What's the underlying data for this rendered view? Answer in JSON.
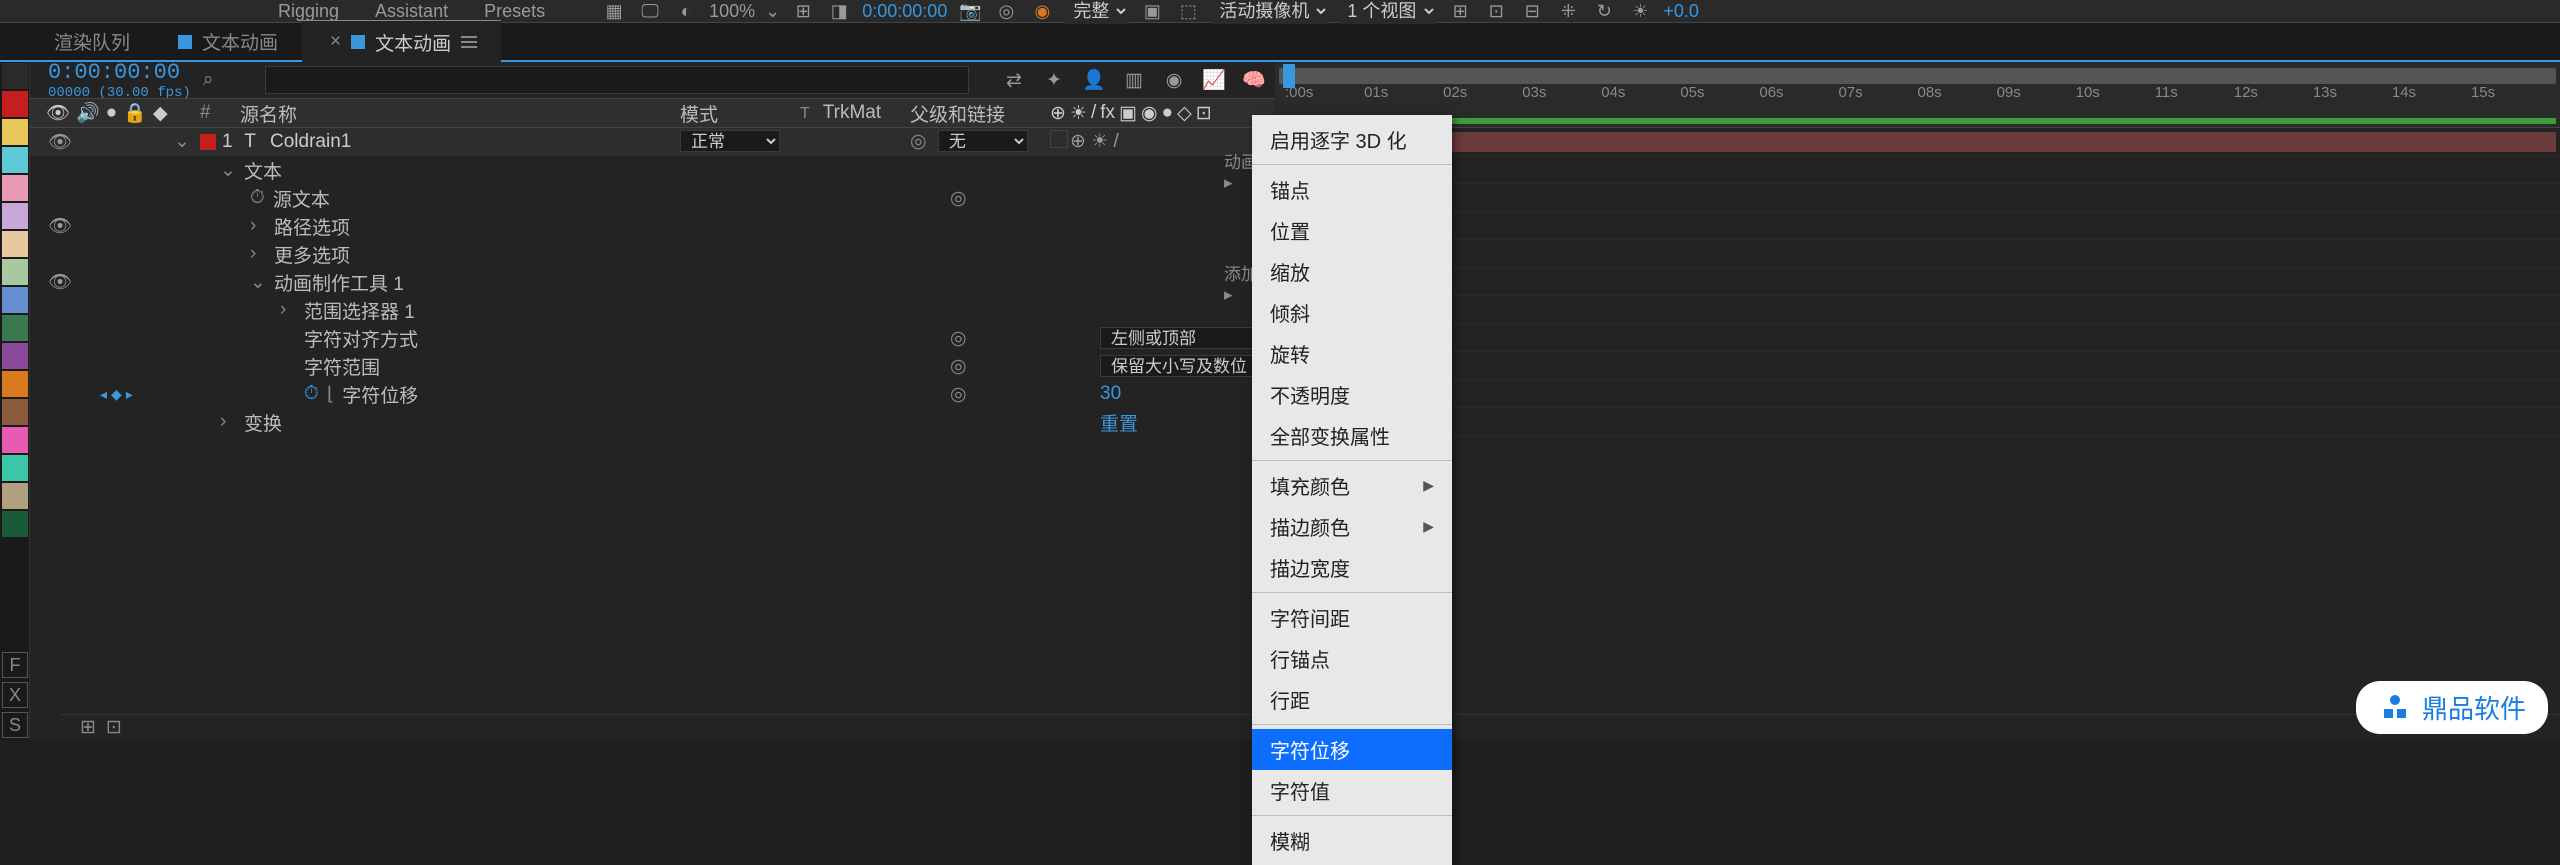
{
  "toolbar": {
    "tabs": [
      "Rigging",
      "Assistant",
      "Presets"
    ],
    "zoom": "100%",
    "timecode": "0:00:00:00",
    "quality": "完整",
    "camera": "活动摄像机",
    "views": "1 个视图",
    "exposure": "+0.0"
  },
  "panel_tabs": {
    "tab1": "渲染队列",
    "tab2": "文本动画",
    "tab3": "文本动画"
  },
  "timeline": {
    "timecode": "0:00:00:00",
    "frame_info": "00000 (30.00 fps)",
    "search_placeholder": "",
    "columns": {
      "hash": "#",
      "source_name": "源名称",
      "mode": "模式",
      "t": "T",
      "trkmat": "TrkMat",
      "parent": "父级和链接"
    },
    "ruler_ticks": [
      ":00s",
      "01s",
      "02s",
      "03s",
      "04s",
      "05s",
      "06s",
      "07s",
      "08s",
      "09s",
      "10s",
      "11s",
      "12s",
      "13s",
      "14s",
      "15s"
    ]
  },
  "layers": {
    "main": {
      "index": "1",
      "name": "Coldrain1",
      "mode": "正常",
      "parent": "无"
    },
    "text_group": "文本",
    "source_text": "源文本",
    "path_options": "路径选项",
    "more_options": "更多选项",
    "animator": "动画制作工具 1",
    "range_selector": "范围选择器 1",
    "char_align": "字符对齐方式",
    "char_range": "字符范围",
    "char_offset": "字符位移",
    "transform": "变换",
    "animate_label": "动画:",
    "add_label": "添加:",
    "align_value": "左侧或顶部",
    "range_value": "保留大小写及数位",
    "offset_value": "30",
    "reset": "重置"
  },
  "context_menu": {
    "enable_3d": "启用逐字 3D 化",
    "anchor": "锚点",
    "position": "位置",
    "scale": "缩放",
    "skew": "倾斜",
    "rotation": "旋转",
    "opacity": "不透明度",
    "all_transform": "全部变换属性",
    "fill_color": "填充颜色",
    "stroke_color": "描边颜色",
    "stroke_width": "描边宽度",
    "tracking": "字符间距",
    "line_anchor": "行锚点",
    "line_spacing": "行距",
    "char_offset": "字符位移",
    "char_value": "字符值",
    "blur": "模糊"
  },
  "color_swatches": [
    "#2a2a2a",
    "#c41e1e",
    "#d97a1e",
    "#d9c31e",
    "#7ad91e",
    "#1ed978",
    "#1ec3d9",
    "#1e7ad9",
    "#5a5ad9",
    "#9a5ad9",
    "#d95ac3",
    "#d95a78",
    "#8a5a3a",
    "#d91e1e",
    "#d95a9a",
    "#1e9a9a",
    "#5a9a5a"
  ],
  "letter_boxes": [
    "F",
    "X",
    "S"
  ],
  "watermark": {
    "text": "鼎品软件"
  }
}
